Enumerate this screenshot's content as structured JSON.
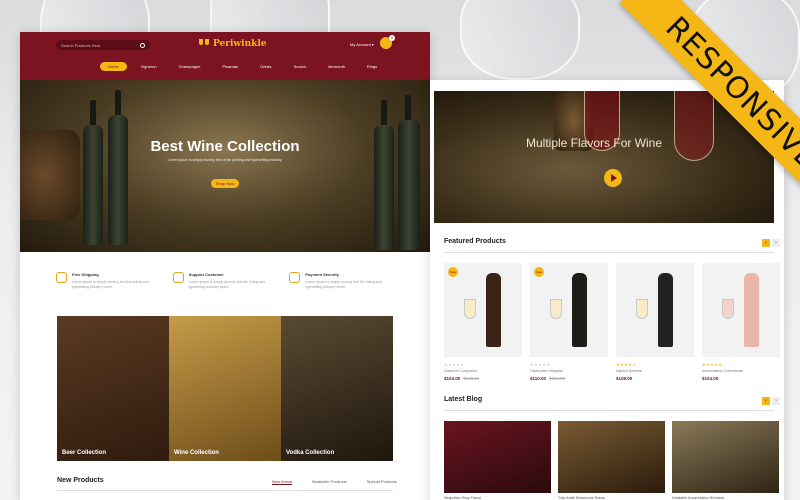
{
  "ribbon": {
    "label": "RESPONSIVE"
  },
  "desktop": {
    "header": {
      "search_placeholder": "Search Products Here",
      "logo": "Periwinkle",
      "account": "My Account",
      "cart_count": "0"
    },
    "nav": [
      "Home",
      "Vigneron",
      "Champagne",
      "Picardan",
      "Drinks",
      "Scotch",
      "Vermouth",
      "Rings"
    ],
    "hero": {
      "title": "Best Wine Collection",
      "subtitle": "Lorem Ipsum is simply dummy text of the printing and typesetting industry.",
      "button": "Shop Now"
    },
    "features": [
      {
        "icon": "truck-icon",
        "title": "Free Shipping",
        "text": "Lorem ipsum is simply dummy text the inding and typesetting industry lorem."
      },
      {
        "icon": "support-icon",
        "title": "Support Customer",
        "text": "Lorem ipsum is simply dummy text the inding and typesetting industry lorem."
      },
      {
        "icon": "payment-icon",
        "title": "Payment Security",
        "text": "Lorem ipsum is simply dummy text the inding and typesetting industry lorem."
      }
    ],
    "categories": [
      "Beer Collection",
      "Wine Collection",
      "Vodka Collection"
    ],
    "new_products": {
      "title": "New Products",
      "tabs": [
        "New Arrival",
        "Bestseller Products",
        "Special Products"
      ]
    }
  },
  "tablet": {
    "hero_title": "Multiple Flavors For Wine",
    "featured": {
      "title": "Featured Products",
      "products": [
        {
          "badge": "Sale",
          "name": "Cabernet Compositor",
          "price": "$104.00",
          "old_price": "$118.00",
          "rating": 0,
          "bottle_color": "#3a2418"
        },
        {
          "badge": "Sale",
          "name": "Capsicabin Hamplian",
          "price": "$110.00",
          "old_price": "$125.00",
          "rating": 0,
          "bottle_color": "#1e1c17"
        },
        {
          "badge": "",
          "name": "Adjunct Queenie",
          "price": "$108.00",
          "old_price": "",
          "rating": 4,
          "bottle_color": "#202320"
        },
        {
          "badge": "",
          "name": "Accumulation Greenhouse",
          "price": "$104.00",
          "old_price": "",
          "rating": 5,
          "bottle_color": "#e8b5a8"
        }
      ]
    },
    "blog": {
      "title": "Latest Blog",
      "posts": [
        {
          "title": "Neapolitan Sirup Faroid"
        },
        {
          "title": "Gulp Addle Brewhouse Rotula"
        },
        {
          "title": "Inimitable Accumulation Richness"
        }
      ]
    },
    "accent": "#f5b716",
    "brand": "#7b1320"
  }
}
